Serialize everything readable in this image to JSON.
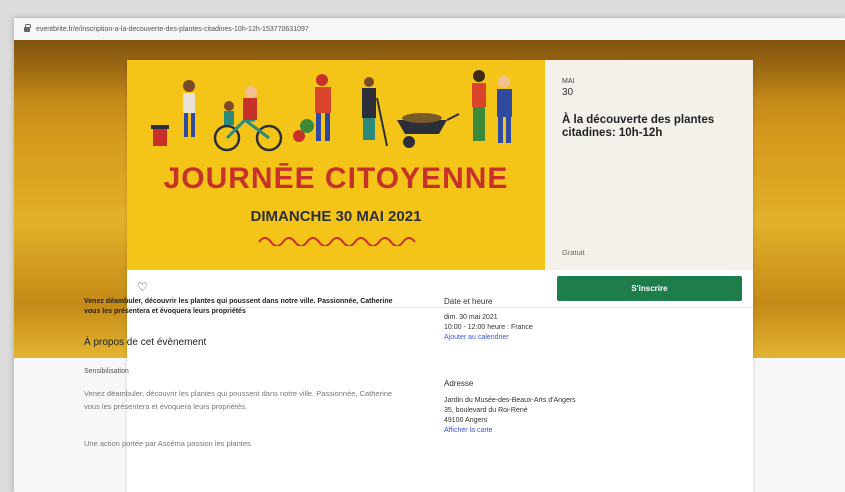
{
  "browser": {
    "url": "eventbrite.fr/e/inscription-a-la-decouverte-des-plantes-citadines-10h-12h-153770631097"
  },
  "banner": {
    "title": "JOURNĒE CITOYENNE",
    "subtitle": "DIMANCHE 30 MAI 2021"
  },
  "event": {
    "month": "MAI",
    "day": "30",
    "title": "À la découverte des plantes citadines: 10h-12h",
    "price": "Gratuit"
  },
  "actions": {
    "register_label": "S'inscrire",
    "like_icon": "heart-outline-icon"
  },
  "content": {
    "lede": "Venez déambuler, découvrir les plantes qui poussent dans notre ville. Passionnée, Catherine vous les présentera et évoquera leurs propriétés",
    "about_heading": "À propos de cet évènement",
    "category": "Sensibilisation",
    "description": "Venez déambuler, découvrir les plantes qui poussent dans notre ville. Passionnée, Catherine vous les présentera et évoquera leurs propriétés.",
    "organizer_line": "Une action portée par Ascéma passion les plantes"
  },
  "sidebar": {
    "datetime_heading": "Date et heure",
    "date": "dim. 30 mai 2021",
    "time": "10:00 - 12:00 heure : France",
    "add_calendar": "Ajouter au calendrier",
    "address_heading": "Adresse",
    "venue": "Jardin du Musée-des-Beaux-Arts d'Angers",
    "street": "35, boulevard du Roi-René",
    "city": "49100 Angers",
    "map_link": "Afficher la carte"
  },
  "colors": {
    "banner": "#f4c418",
    "title_red": "#c8302a",
    "register_green": "#1e7d4b",
    "link_blue": "#3659e3"
  }
}
